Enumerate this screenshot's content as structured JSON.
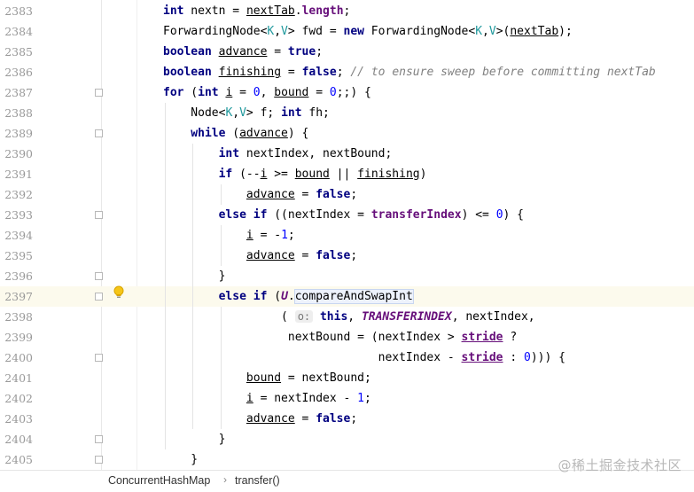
{
  "editor": {
    "lines": [
      {
        "num": "2383",
        "segs": [
          [
            "        ",
            ""
          ],
          [
            "int",
            "k"
          ],
          [
            " nextn = ",
            ""
          ],
          [
            "nextTab",
            "u"
          ],
          [
            ".",
            ""
          ],
          [
            "length",
            "f"
          ],
          [
            ";",
            ""
          ]
        ]
      },
      {
        "num": "2384",
        "segs": [
          [
            "        ForwardingNode",
            ""
          ],
          [
            "<",
            ""
          ],
          [
            "K",
            "g"
          ],
          [
            ",",
            ""
          ],
          [
            "V",
            "g"
          ],
          [
            "> fwd = ",
            ""
          ],
          [
            "new",
            "k"
          ],
          [
            " ForwardingNode",
            ""
          ],
          [
            "<",
            ""
          ],
          [
            "K",
            "g"
          ],
          [
            ",",
            ""
          ],
          [
            "V",
            "g"
          ],
          [
            ">(",
            ""
          ],
          [
            "nextTab",
            "u"
          ],
          [
            ");",
            ""
          ]
        ]
      },
      {
        "num": "2385",
        "segs": [
          [
            "        ",
            ""
          ],
          [
            "boolean",
            "k"
          ],
          [
            " ",
            ""
          ],
          [
            "advance",
            "u"
          ],
          [
            " = ",
            ""
          ],
          [
            "true",
            "k"
          ],
          [
            ";",
            ""
          ]
        ]
      },
      {
        "num": "2386",
        "segs": [
          [
            "        ",
            ""
          ],
          [
            "boolean",
            "k"
          ],
          [
            " ",
            ""
          ],
          [
            "finishing",
            "u"
          ],
          [
            " = ",
            ""
          ],
          [
            "false",
            "k"
          ],
          [
            "; ",
            ""
          ],
          [
            "// to ensure sweep before committing nextTab",
            "c"
          ]
        ]
      },
      {
        "num": "2387",
        "segs": [
          [
            "        ",
            ""
          ],
          [
            "for",
            "k"
          ],
          [
            " (",
            ""
          ],
          [
            "int",
            "k"
          ],
          [
            " ",
            ""
          ],
          [
            "i",
            "u"
          ],
          [
            " = ",
            ""
          ],
          [
            "0",
            "n"
          ],
          [
            ", ",
            ""
          ],
          [
            "bound",
            "u"
          ],
          [
            " = ",
            ""
          ],
          [
            "0",
            "n"
          ],
          [
            ";;) {",
            ""
          ]
        ]
      },
      {
        "num": "2388",
        "segs": [
          [
            "            Node",
            ""
          ],
          [
            "<",
            ""
          ],
          [
            "K",
            "g"
          ],
          [
            ",",
            ""
          ],
          [
            "V",
            "g"
          ],
          [
            "> f; ",
            ""
          ],
          [
            "int",
            "k"
          ],
          [
            " fh;",
            ""
          ]
        ]
      },
      {
        "num": "2389",
        "segs": [
          [
            "            ",
            ""
          ],
          [
            "while",
            "k"
          ],
          [
            " (",
            ""
          ],
          [
            "advance",
            "u"
          ],
          [
            ") {",
            ""
          ]
        ]
      },
      {
        "num": "2390",
        "segs": [
          [
            "                ",
            ""
          ],
          [
            "int",
            "k"
          ],
          [
            " nextIndex, nextBound;",
            ""
          ]
        ]
      },
      {
        "num": "2391",
        "segs": [
          [
            "                ",
            ""
          ],
          [
            "if",
            "k"
          ],
          [
            " (--",
            ""
          ],
          [
            "i",
            "u"
          ],
          [
            " >= ",
            ""
          ],
          [
            "bound",
            "u"
          ],
          [
            " || ",
            ""
          ],
          [
            "finishing",
            "u"
          ],
          [
            ")",
            ""
          ]
        ]
      },
      {
        "num": "2392",
        "segs": [
          [
            "                    ",
            ""
          ],
          [
            "advance",
            "u"
          ],
          [
            " = ",
            ""
          ],
          [
            "false",
            "k"
          ],
          [
            ";",
            ""
          ]
        ]
      },
      {
        "num": "2393",
        "segs": [
          [
            "                ",
            ""
          ],
          [
            "else if",
            "k"
          ],
          [
            " ((nextIndex = ",
            ""
          ],
          [
            "transferIndex",
            "f"
          ],
          [
            ") <= ",
            ""
          ],
          [
            "0",
            "n"
          ],
          [
            ") {",
            ""
          ]
        ]
      },
      {
        "num": "2394",
        "segs": [
          [
            "                    ",
            ""
          ],
          [
            "i",
            "u"
          ],
          [
            " = -",
            ""
          ],
          [
            "1",
            "n"
          ],
          [
            ";",
            ""
          ]
        ]
      },
      {
        "num": "2395",
        "segs": [
          [
            "                    ",
            ""
          ],
          [
            "advance",
            "u"
          ],
          [
            " = ",
            ""
          ],
          [
            "false",
            "k"
          ],
          [
            ";",
            ""
          ]
        ]
      },
      {
        "num": "2396",
        "segs": [
          [
            "                }",
            ""
          ]
        ]
      },
      {
        "num": "2397",
        "segs": [
          [
            "                ",
            ""
          ],
          [
            "else if",
            "k"
          ],
          [
            " (",
            ""
          ],
          [
            "U",
            "uitalic"
          ],
          [
            ".",
            ""
          ],
          [
            "compareAndSwapInt",
            "param-sel"
          ]
        ]
      },
      {
        "num": "2398",
        "segs": [
          [
            "                         ( ",
            ""
          ],
          [
            "o:",
            "hint"
          ],
          [
            " ",
            ""
          ],
          [
            "this",
            "k"
          ],
          [
            ", ",
            ""
          ],
          [
            "TRANSFERINDEX",
            "fi"
          ],
          [
            ", nextIndex,",
            ""
          ]
        ]
      },
      {
        "num": "2399",
        "segs": [
          [
            "                          nextBound = (nextIndex > ",
            ""
          ],
          [
            "stride",
            "f u"
          ],
          [
            " ?",
            ""
          ]
        ]
      },
      {
        "num": "2400",
        "segs": [
          [
            "                                       nextIndex - ",
            ""
          ],
          [
            "stride",
            "f u"
          ],
          [
            " : ",
            ""
          ],
          [
            "0",
            "n"
          ],
          [
            "))) {",
            ""
          ]
        ]
      },
      {
        "num": "2401",
        "segs": [
          [
            "                    ",
            ""
          ],
          [
            "bound",
            "u"
          ],
          [
            " = nextBound;",
            ""
          ]
        ]
      },
      {
        "num": "2402",
        "segs": [
          [
            "                    ",
            ""
          ],
          [
            "i",
            "u"
          ],
          [
            " = nextIndex - ",
            ""
          ],
          [
            "1",
            "n"
          ],
          [
            ";",
            ""
          ]
        ]
      },
      {
        "num": "2403",
        "segs": [
          [
            "                    ",
            ""
          ],
          [
            "advance",
            "u"
          ],
          [
            " = ",
            ""
          ],
          [
            "false",
            "k"
          ],
          [
            ";",
            ""
          ]
        ]
      },
      {
        "num": "2404",
        "segs": [
          [
            "                }",
            ""
          ]
        ]
      },
      {
        "num": "2405",
        "segs": [
          [
            "            }",
            ""
          ]
        ]
      }
    ],
    "current_line": "2397"
  },
  "breadcrumb": {
    "items": [
      "ConcurrentHashMap",
      "transfer()"
    ],
    "separator": "›"
  },
  "watermark": "@稀土掘金技术社区",
  "icons": {
    "intention": "lightbulb-icon",
    "fold": "fold-marker-icon"
  },
  "colors": {
    "keyword": "#000080",
    "field": "#660e7a",
    "generic": "#20999d",
    "number": "#0000ff",
    "comment": "#808080",
    "current_line_bg": "#fcfaed"
  }
}
